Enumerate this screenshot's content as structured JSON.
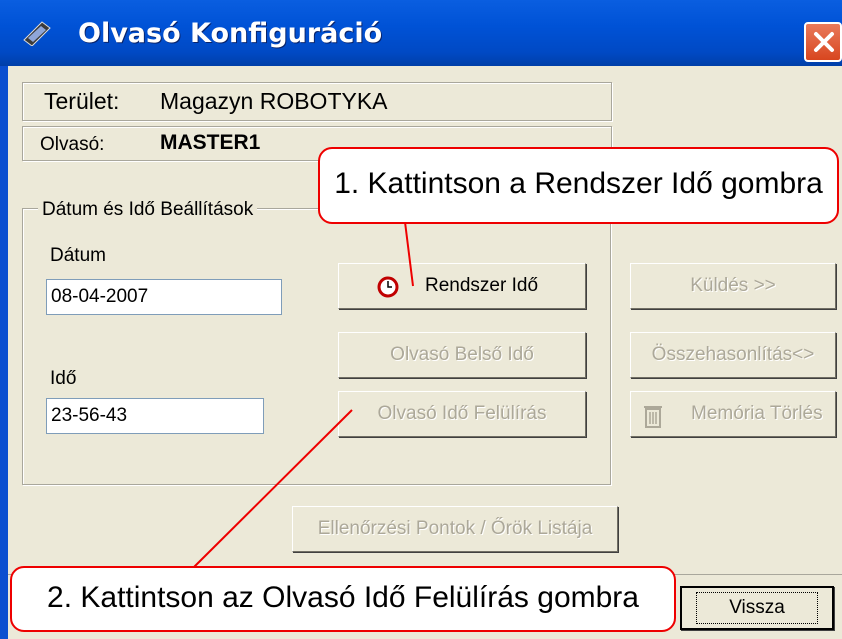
{
  "window": {
    "title": "Olvasó Konfiguráció"
  },
  "info": {
    "area_label": "Terület:",
    "area_value": "Magazyn ROBOTYKA",
    "reader_label": "Olvasó:",
    "reader_value": "MASTER1"
  },
  "group": {
    "legend": "Dátum és Idő Beállítások",
    "date_label": "Dátum",
    "date_value": "08-04-2007",
    "time_label": "Idő",
    "time_value": "23-56-43"
  },
  "buttons": {
    "system_time": "Rendszer Idő",
    "reader_internal_time": "Olvasó Belső Idő",
    "reader_time_override": "Olvasó Idő Felülírás",
    "send": "Küldés >>",
    "compare": "Összehasonlítás<>",
    "clear_memory": "Memória Törlés",
    "checkpoints_list": "Ellenőrzési Pontok / Őrök Listája",
    "back": "Vissza"
  },
  "callouts": {
    "step1": "1. Kattintson a Rendszer Idő gombra",
    "step2": "2. Kattintson az Olvasó Idő Felülírás gombra"
  },
  "colors": {
    "callout_border": "#e00000",
    "titlebar": "#0052d6",
    "window_bg": "#ece9d8"
  },
  "icons": [
    "reader-app-icon",
    "close-icon",
    "clock-icon",
    "trash-icon"
  ]
}
